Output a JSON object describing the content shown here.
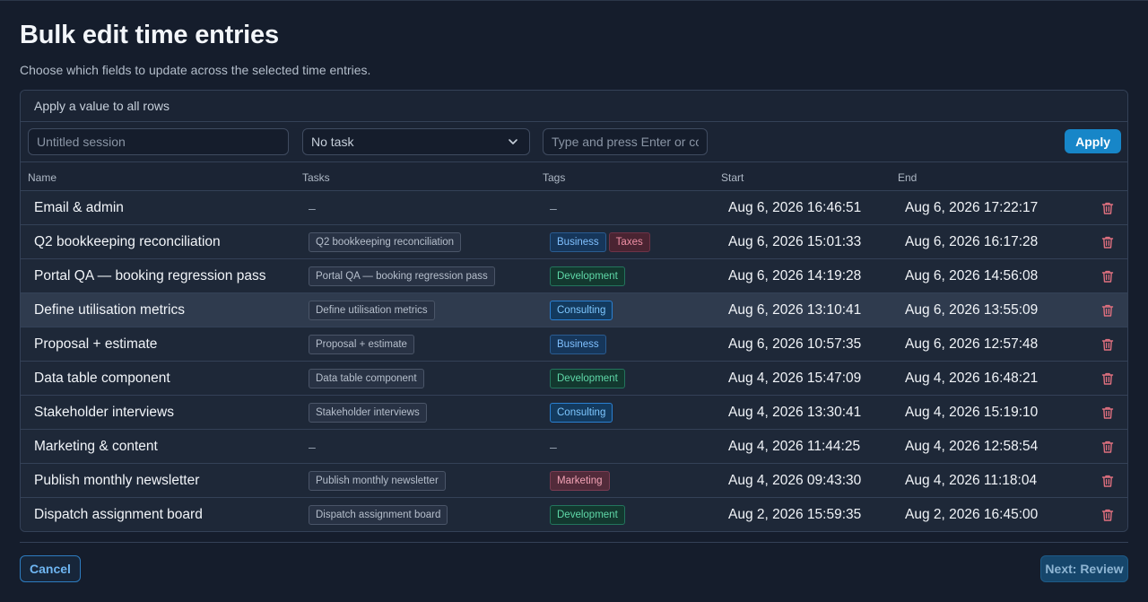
{
  "page": {
    "title": "Bulk edit time entries",
    "subtitle": "Choose which fields to update across the selected time entries."
  },
  "apply_bar": {
    "label": "Apply a value to all rows",
    "name_placeholder": "Untitled session",
    "task_select_value": "No task",
    "tags_placeholder": "Type and press Enter or comma",
    "apply_label": "Apply"
  },
  "columns": {
    "name": "Name",
    "tasks": "Tasks",
    "tags": "Tags",
    "start": "Start",
    "end": "End"
  },
  "rows": [
    {
      "name": "Email & admin",
      "task": "–",
      "tags": [],
      "start": "Aug 6, 2026 16:46:51",
      "end": "Aug 6, 2026 17:22:17"
    },
    {
      "name": "Q2 bookkeeping reconciliation",
      "task": "Q2 bookkeeping reconciliation",
      "tags": [
        "Business",
        "Taxes"
      ],
      "start": "Aug 6, 2026 15:01:33",
      "end": "Aug 6, 2026 16:17:28"
    },
    {
      "name": "Portal QA — booking regression pass",
      "task": "Portal QA — booking regression pass",
      "tags": [
        "Development"
      ],
      "start": "Aug 6, 2026 14:19:28",
      "end": "Aug 6, 2026 14:56:08"
    },
    {
      "name": "Define utilisation metrics",
      "task": "Define utilisation metrics",
      "tags": [
        "Consulting"
      ],
      "start": "Aug 6, 2026 13:10:41",
      "end": "Aug 6, 2026 13:55:09",
      "highlighted": true
    },
    {
      "name": "Proposal + estimate",
      "task": "Proposal + estimate",
      "tags": [
        "Business"
      ],
      "start": "Aug 6, 2026 10:57:35",
      "end": "Aug 6, 2026 12:57:48"
    },
    {
      "name": "Data table component",
      "task": "Data table component",
      "tags": [
        "Development"
      ],
      "start": "Aug 4, 2026 15:47:09",
      "end": "Aug 4, 2026 16:48:21"
    },
    {
      "name": "Stakeholder interviews",
      "task": "Stakeholder interviews",
      "tags": [
        "Consulting"
      ],
      "start": "Aug 4, 2026 13:30:41",
      "end": "Aug 4, 2026 15:19:10"
    },
    {
      "name": "Marketing & content",
      "task": "–",
      "tags": [],
      "start": "Aug 4, 2026 11:44:25",
      "end": "Aug 4, 2026 12:58:54"
    },
    {
      "name": "Publish monthly newsletter",
      "task": "Publish monthly newsletter",
      "tags": [
        "Marketing"
      ],
      "start": "Aug 4, 2026 09:43:30",
      "end": "Aug 4, 2026 11:18:04"
    },
    {
      "name": "Dispatch assignment board",
      "task": "Dispatch assignment board",
      "tags": [
        "Development"
      ],
      "start": "Aug 2, 2026 15:59:35",
      "end": "Aug 2, 2026 16:45:00"
    }
  ],
  "empty_placeholder": "–",
  "footer": {
    "cancel_label": "Cancel",
    "next_label": "Next: Review"
  },
  "colors": {
    "accent": "#1786c8",
    "delete_icon": "#e0707f",
    "background": "#151d2c"
  }
}
